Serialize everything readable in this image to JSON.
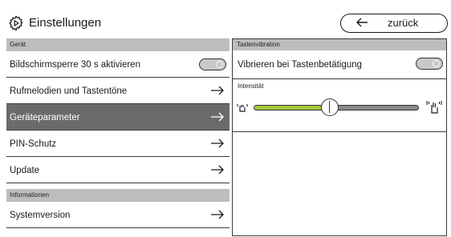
{
  "header": {
    "title": "Einstellungen",
    "back_label": "zurück"
  },
  "left": {
    "section_device": "Gerät",
    "items": [
      {
        "label": "Bildschirmsperre 30 s aktivieren",
        "control": "toggle",
        "toggle_on": false
      },
      {
        "label": "Rufmelodien und Tastentöne",
        "control": "arrow"
      },
      {
        "label": "Geräteparameter",
        "control": "arrow",
        "active": true
      },
      {
        "label": "PIN-Schutz",
        "control": "arrow"
      },
      {
        "label": "Update",
        "control": "arrow"
      }
    ],
    "section_info": "Informationen",
    "info_items": [
      {
        "label": "Systemversion",
        "control": "arrow"
      }
    ]
  },
  "right": {
    "section": "Tastenvibration",
    "vibrate_label": "Vibrieren bei Tastenbetätigung",
    "vibrate_on": false,
    "intensity_label": "Intensität",
    "intensity_value": 0.46
  },
  "colors": {
    "accent": "#a4c639",
    "section_bg": "#bdbdbd",
    "active_row": "#6b6b6b"
  },
  "icons": {
    "title": "gear-icon",
    "back": "arrow-left-icon",
    "row": "arrow-right-icon",
    "intensity_min": "vibration-low-icon",
    "intensity_max": "vibration-high-icon"
  }
}
